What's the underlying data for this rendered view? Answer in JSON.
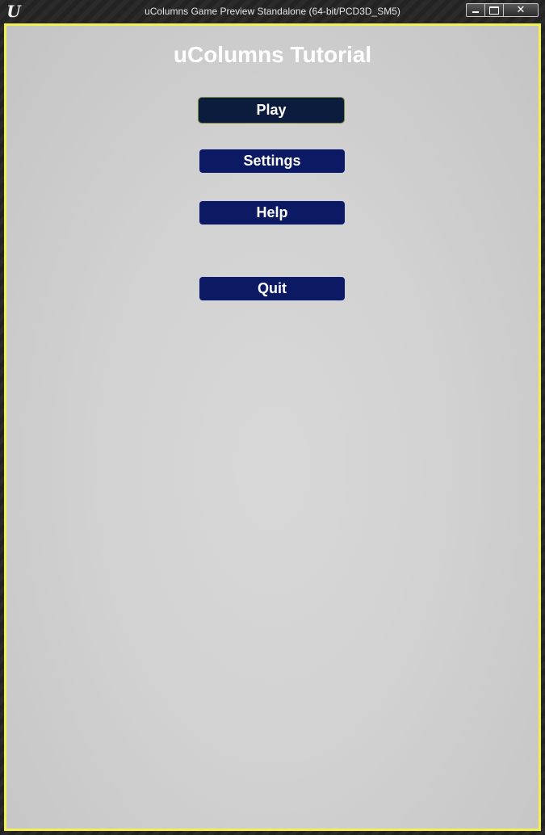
{
  "window": {
    "title": "uColumns Game Preview Standalone (64-bit/PCD3D_SM5)",
    "logo_icon": "unreal-engine-logo-icon",
    "logo_glyph": "U",
    "controls": {
      "minimize_icon": "minimize-icon",
      "maximize_icon": "maximize-icon",
      "close_icon": "close-icon",
      "close_glyph": "✕"
    }
  },
  "game": {
    "title": "uColumns Tutorial",
    "menu": {
      "play_label": "Play",
      "settings_label": "Settings",
      "help_label": "Help",
      "quit_label": "Quit"
    }
  },
  "colors": {
    "viewport_border": "#f2ef52",
    "button_fill": "#0b1a63",
    "button_hover_fill": "#0c1c3c",
    "background": "#d2d2d2"
  }
}
